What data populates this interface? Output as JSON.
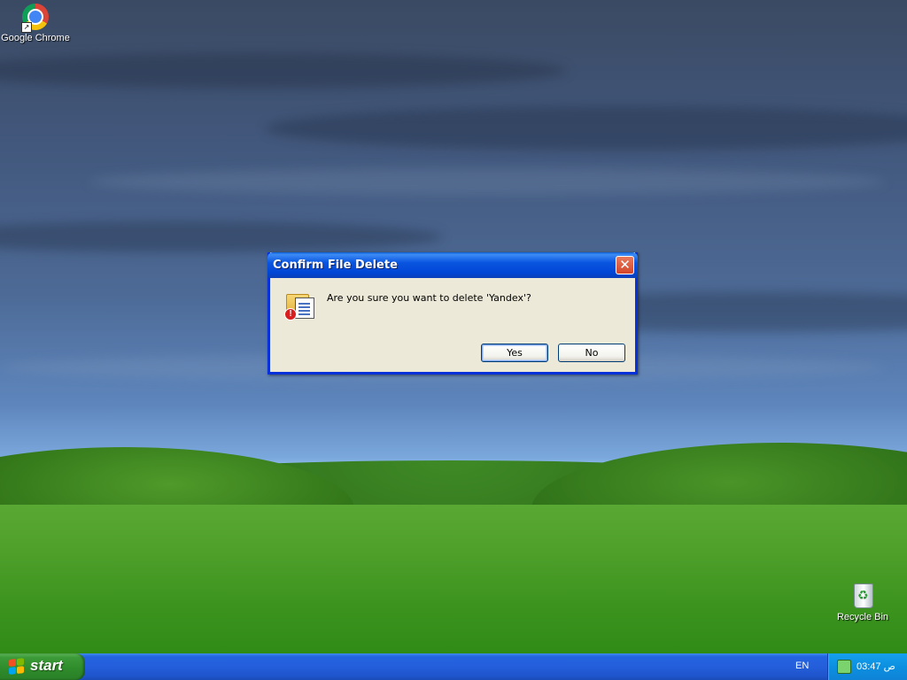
{
  "desktop": {
    "icons": [
      {
        "label": "Google Chrome",
        "icon": "chrome-icon"
      },
      {
        "label": "Recycle Bin",
        "icon": "recycle-bin-icon"
      }
    ]
  },
  "dialog": {
    "title": "Confirm File Delete",
    "message": "Are you sure you want to delete 'Yandex'?",
    "close_label": "✕",
    "yes_label": "Yes",
    "no_label": "No",
    "icon": "delete-file-warning-icon"
  },
  "taskbar": {
    "start_label": "start",
    "language": "EN",
    "clock": "ص 03:47"
  },
  "colors": {
    "title_bar": "#0a55e0",
    "dialog_bg": "#ece9d8",
    "taskbar": "#245edb",
    "start_button": "#3c9a38",
    "tray": "#0c8fe0"
  }
}
